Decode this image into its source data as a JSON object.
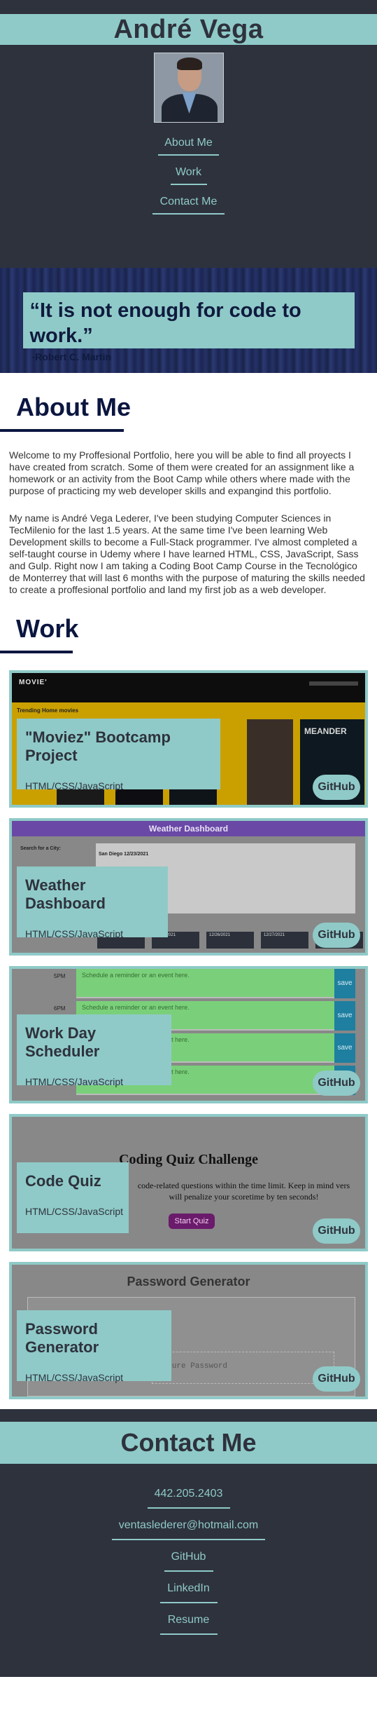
{
  "header": {
    "name": "André Vega",
    "nav": [
      "About Me",
      "Work",
      "Contact Me"
    ]
  },
  "quote": {
    "text": "“It is not enough for code to work.”",
    "author": "-Robert C. Martin"
  },
  "about": {
    "heading": "About Me",
    "paragraph1": "Welcome to my Proffesional Portfolio, here you will be able to find all proyects I have created from scratch. Some of them were created for an assignment like a homework or an activity from the Boot Camp while others where made with the purpose of practicing my web developer skills and expangind this portfolio.",
    "paragraph2": "My name is André Vega Lederer, I've been studying Computer Sciences in TecMilenio for the last 1.5 years. At the same time I've been learning Web Development skills to become a Full-Stack programmer. I've almost completed a self-taught course in Udemy where I have learned HTML, CSS, JavaScript, Sass and Gulp. Right now I am taking a Coding Boot Camp Course in the Tecnológico de Monterrey that will last 6 months with the purpose of maturing the skills needed to create a proffesional portfolio and land my first job as a web developer."
  },
  "work": {
    "heading": "Work",
    "github_label": "GitHub",
    "projects": [
      {
        "title": "\"Moviez\" Bootcamp Project",
        "tech": "HTML/CSS/JavaScript",
        "shot": {
          "logo": "MOVIE'",
          "trending": "Trending Home movies",
          "poster_text": "MEANDER"
        }
      },
      {
        "title": "Weather Dashboard",
        "tech": "HTML/CSS/JavaScript",
        "shot": {
          "header": "Weather Dashboard",
          "search": "Search for a City:",
          "city": "San Diego 12/23/2021",
          "dates": [
            "12/25/2021",
            "12/26/2021",
            "12/27/2021"
          ]
        }
      },
      {
        "title": "Work Day Scheduler",
        "tech": "HTML/CSS/JavaScript",
        "shot": {
          "time": "5PM",
          "time2": "6PM",
          "placeholder": "Schedule a reminder or an event here.",
          "save": "save"
        }
      },
      {
        "title": "Code Quiz",
        "tech": "HTML/CSS/JavaScript",
        "shot": {
          "title": "Coding Quiz Challenge",
          "text": "code-related questions within the time limit. Keep in mind vers will penalize your scoretime by ten seconds!",
          "button": "Start Quiz"
        }
      },
      {
        "title": "Password Generator",
        "tech": "HTML/CSS/JavaScript",
        "shot": {
          "title": "Password Generator",
          "input": "Secure Password"
        }
      }
    ]
  },
  "contact": {
    "heading": "Contact Me",
    "phone": "442.205.2403",
    "email": "ventaslederer@hotmail.com",
    "github": "GitHub",
    "linkedin": "LinkedIn",
    "resume": "Resume"
  },
  "colors": {
    "accent": "#8fcac8",
    "dark": "#2e323d",
    "navy": "#0b1640"
  }
}
